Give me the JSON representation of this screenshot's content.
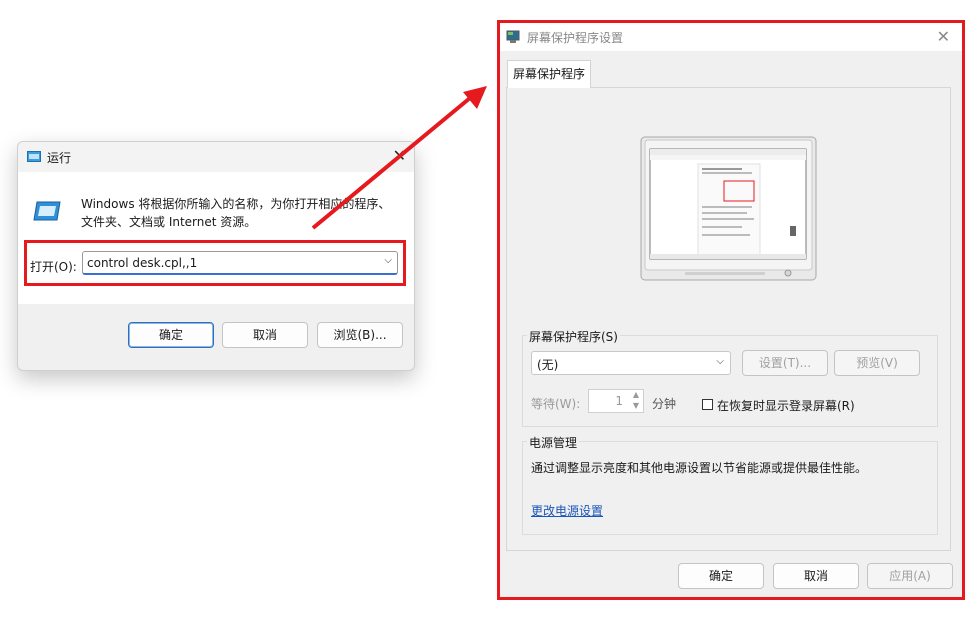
{
  "run_dialog": {
    "title": "运行",
    "description": "Windows 将根据你所输入的名称，为你打开相应的程序、文件夹、文档或 Internet 资源。",
    "open_label": "打开(O):",
    "command_value": "control desk.cpl,,1",
    "ok_label": "确定",
    "cancel_label": "取消",
    "browse_label": "浏览(B)..."
  },
  "screensaver_dialog": {
    "title": "屏幕保护程序设置",
    "tab_label": "屏幕保护程序",
    "screensaver_group_title": "屏幕保护程序(S)",
    "screensaver_selected": "(无)",
    "settings_button": "设置(T)...",
    "preview_button": "预览(V)",
    "wait_label": "等待(W):",
    "wait_value": "1",
    "wait_unit": "分钟",
    "resume_checkbox_label": "在恢复时显示登录屏幕(R)",
    "resume_checked": false,
    "power_group_title": "电源管理",
    "power_description": "通过调整显示亮度和其他电源设置以节省能源或提供最佳性能。",
    "power_link": "更改电源设置",
    "ok_label": "确定",
    "cancel_label": "取消",
    "apply_label": "应用(A)"
  },
  "colors": {
    "highlight": "#e5191e",
    "link": "#1a55b8",
    "dialog_bg": "#f0f0f0"
  },
  "icons": [
    "run-app-icon",
    "run-big-icon",
    "screensaver-app-icon",
    "close-icon",
    "dropdown-chevron-icon",
    "spin-up-icon",
    "spin-down-icon",
    "monitor-preview-icon"
  ]
}
